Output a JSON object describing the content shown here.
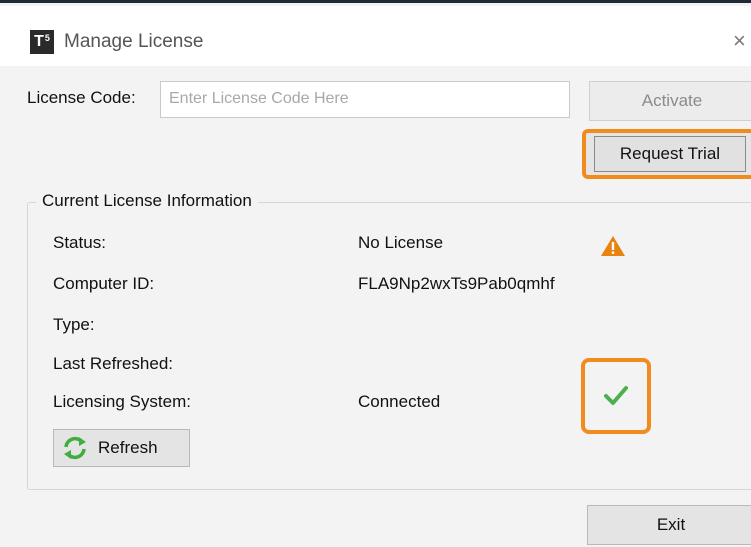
{
  "window": {
    "app_icon_text": "T",
    "app_icon_sup": "5",
    "title": "Manage License",
    "close_glyph": "×"
  },
  "license": {
    "code_label": "License Code:",
    "code_value": "",
    "code_placeholder": "Enter License Code Here",
    "activate_label": "Activate",
    "request_trial_label": "Request Trial"
  },
  "info": {
    "group_title": "Current License Information",
    "rows": [
      {
        "label": "Status:",
        "value": "No License",
        "icon": "warning-icon"
      },
      {
        "label": "Computer ID:",
        "value": "FLA9Np2wxTs9Pab0qmhf"
      },
      {
        "label": "Type:",
        "value": ""
      },
      {
        "label": "Last Refreshed:",
        "value": ""
      },
      {
        "label": "Licensing System:",
        "value": "Connected",
        "icon": "check-icon"
      }
    ],
    "refresh_label": "Refresh"
  },
  "footer": {
    "exit_label": "Exit"
  },
  "colors": {
    "highlight": "#f28b1e",
    "warning": "#e8830f",
    "check": "#4caf50",
    "refresh": "#3fae3f"
  }
}
